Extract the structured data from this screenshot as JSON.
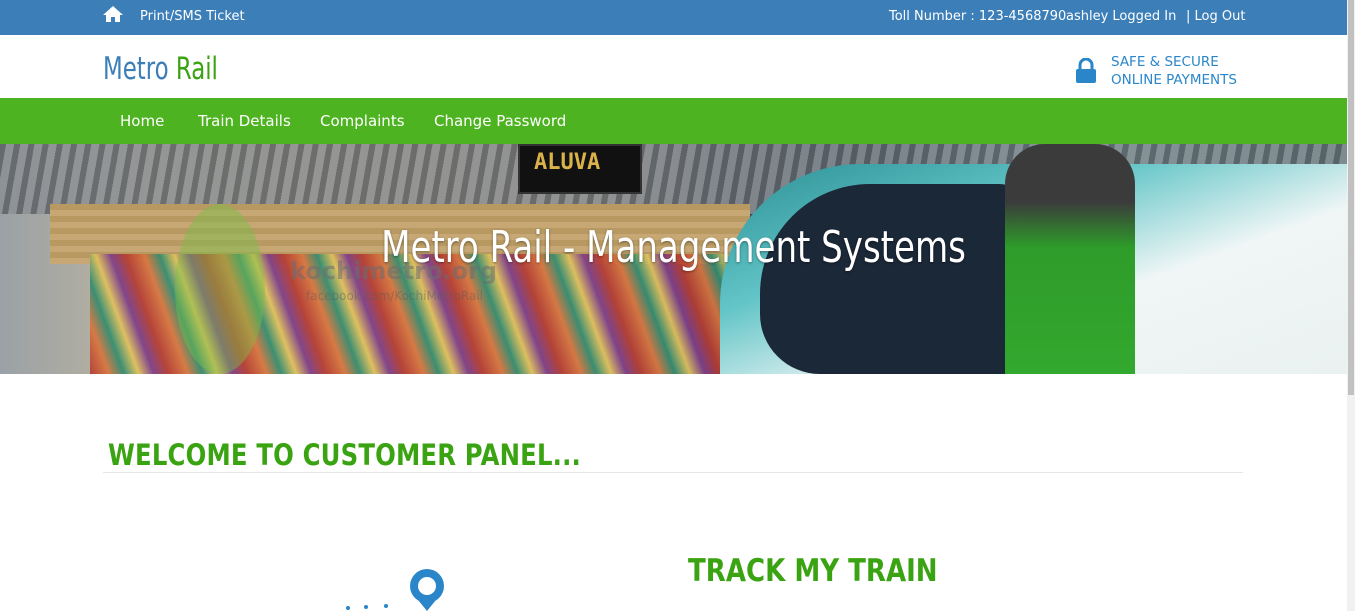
{
  "topbar": {
    "print_label": "Print/SMS Ticket",
    "toll_label": "Toll Number : 123-4568790",
    "user_label": "ashley Logged In",
    "logout_label": "| Log Out"
  },
  "header": {
    "logo_part1": "Metro",
    "logo_part2": "Rail",
    "secure_line1": "SAFE & SECURE",
    "secure_line2": "ONLINE PAYMENTS"
  },
  "nav": {
    "items": [
      {
        "label": "Home"
      },
      {
        "label": "Train Details"
      },
      {
        "label": "Complaints"
      },
      {
        "label": "Change Password"
      }
    ]
  },
  "hero": {
    "title": "Metro Rail - Management Systems",
    "sign_text": "ALUVA",
    "watermark": "kochimetro.org",
    "watermark_sub": "facebook.com/KochiMetroRail"
  },
  "main": {
    "welcome_heading": "WELCOME TO CUSTOMER PANEL...",
    "track_heading": "TRACK MY TRAIN"
  },
  "colors": {
    "topbar": "#3b7eb8",
    "navbar": "#4db320",
    "accent_green": "#3aa312",
    "accent_blue": "#2a86c9"
  },
  "icons": {
    "home": "home-icon",
    "lock": "lock-icon",
    "pin": "map-pin-icon"
  }
}
